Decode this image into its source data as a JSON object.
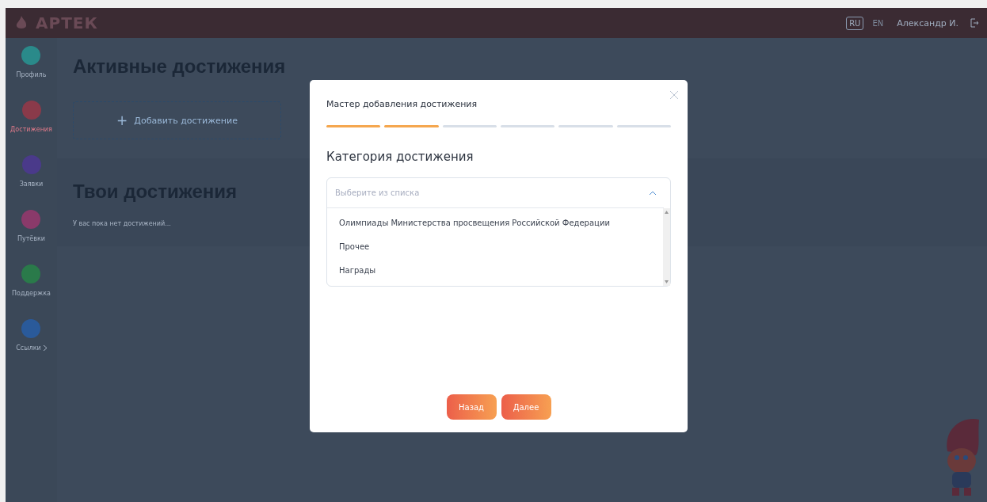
{
  "header": {
    "logo": "АРТЕК",
    "languages": [
      {
        "label": "RU",
        "selected": true
      },
      {
        "label": "EN",
        "selected": false
      }
    ],
    "user": "Александр И."
  },
  "sidebar": {
    "items": [
      {
        "label": "Профиль",
        "selected": false,
        "color": "#2a8a8a"
      },
      {
        "label": "Достижения",
        "selected": true,
        "color": "#8a3a4a"
      },
      {
        "label": "Заявки",
        "selected": false,
        "color": "#4a3a8a"
      },
      {
        "label": "Путёвки",
        "selected": false,
        "color": "#8a3a6a"
      },
      {
        "label": "Поддержка",
        "selected": false,
        "color": "#2a7a4a"
      },
      {
        "label": "Ссылки",
        "selected": false,
        "color": "#2a5a9a",
        "submenu": true
      }
    ]
  },
  "active_section": {
    "title": "Активные достижения",
    "add_button": "+",
    "add_label": "Добавить достижение"
  },
  "my_section": {
    "title": "Твои достижения",
    "empty_text": "У вас пока нет достижений..."
  },
  "dialog": {
    "title": "Мастер добавления достижения",
    "steps": [
      {
        "done": true
      },
      {
        "done": true
      },
      {
        "done": false
      },
      {
        "done": false
      },
      {
        "done": false
      },
      {
        "done": false
      }
    ],
    "field_label": "Категория достижения",
    "select": {
      "placeholder": "Выберите из списка",
      "expanded": true,
      "options": [
        "Олимпиады Министерства просвещения Российской Федерации",
        "Прочее",
        "Награды"
      ]
    },
    "buttons": [
      "Назад",
      "Далее"
    ]
  }
}
